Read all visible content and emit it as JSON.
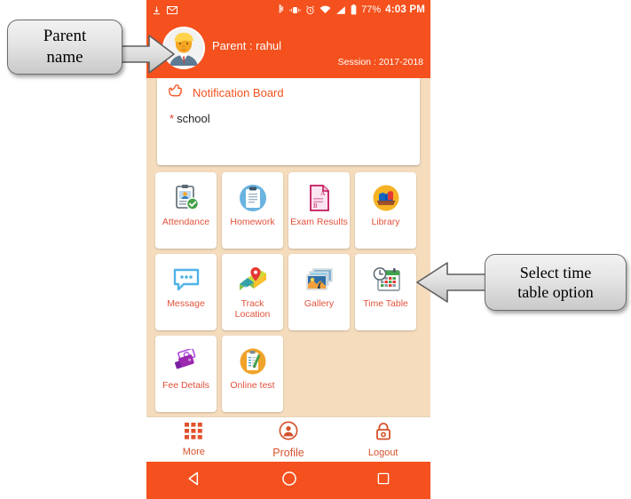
{
  "statusbar": {
    "icons_left": [
      "download-icon",
      "gmail-icon"
    ],
    "icons_right": [
      "bluetooth-icon",
      "vibrate-icon",
      "alarm-icon",
      "wifi-icon",
      "signal-icon",
      "battery-icon"
    ],
    "battery_percent": "77%",
    "time": "4:03 PM"
  },
  "header": {
    "avatar_name": "parent-avatar",
    "parent_label": "Parent : rahul",
    "session_label": "Session : 2017-2018",
    "background_color": "#f4511e"
  },
  "notification": {
    "icon": "pointing-hand-icon",
    "title": "Notification Board",
    "items": [
      {
        "bullet": "*",
        "text": "school"
      }
    ]
  },
  "grid": {
    "tiles": [
      {
        "label": "Attendance",
        "icon": "attendance-clipboard-check-icon"
      },
      {
        "label": "Homework",
        "icon": "homework-clipboard-icon"
      },
      {
        "label": "Exam Results",
        "icon": "exam-results-grade-sheet-icon"
      },
      {
        "label": "Library",
        "icon": "library-books-icon"
      },
      {
        "label": "Message",
        "icon": "message-bubble-icon"
      },
      {
        "label": "Track Location",
        "icon": "map-pin-icon"
      },
      {
        "label": "Gallery",
        "icon": "photos-gallery-icon"
      },
      {
        "label": "Time Table",
        "icon": "calendar-clock-icon"
      },
      {
        "label": "Fee Details",
        "icon": "money-wallet-icon"
      },
      {
        "label": "Online test",
        "icon": "online-test-clipboard-icon"
      }
    ]
  },
  "bottomnav": {
    "items": [
      {
        "label": "More",
        "icon": "grid-apps-icon"
      },
      {
        "label": "Profile",
        "icon": "user-circle-icon"
      },
      {
        "label": "Logout",
        "icon": "lock-icon"
      }
    ],
    "accent_color": "#d4522c"
  },
  "androidnav": {
    "buttons": [
      {
        "name": "back-button",
        "icon": "triangle-back-icon"
      },
      {
        "name": "home-button",
        "icon": "circle-home-icon"
      },
      {
        "name": "recents-button",
        "icon": "square-recents-icon"
      }
    ]
  },
  "annotations": {
    "parent_name": "Parent\nname",
    "parent_name_line1": "Parent",
    "parent_name_line2": "name",
    "time_table_line1": "Select time",
    "time_table_line2": "table option"
  },
  "colors": {
    "primary": "#f4511e",
    "page_background": "#f4dcbd",
    "tile_label": "#e2513a"
  }
}
